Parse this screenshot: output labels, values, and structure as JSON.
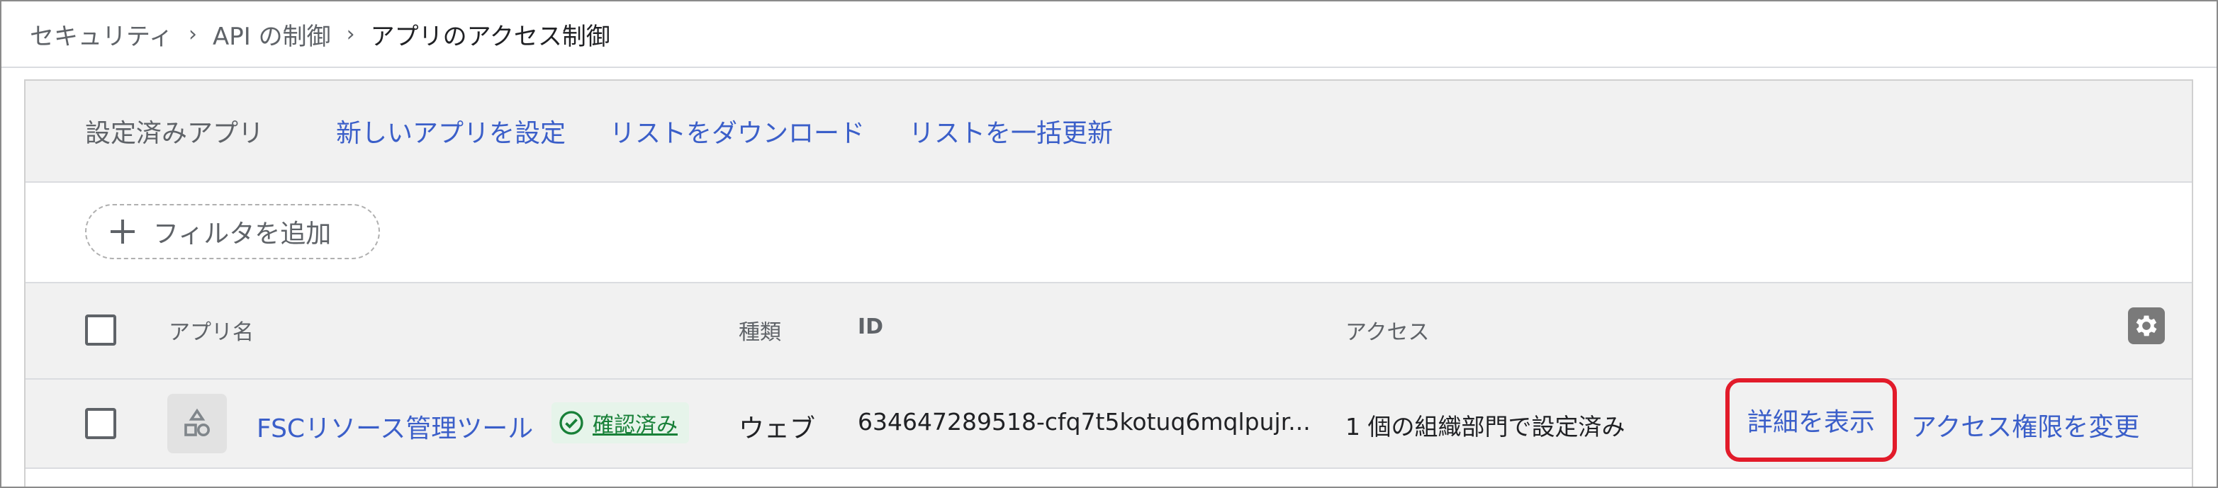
{
  "breadcrumb": {
    "items": [
      "セキュリティ",
      "API の制御",
      "アプリのアクセス制御"
    ],
    "separator": "›"
  },
  "toolbar": {
    "title": "設定済みアプリ",
    "configure_new_app": "新しいアプリを設定",
    "download_list": "リストをダウンロード",
    "bulk_update_list": "リストを一括更新"
  },
  "filter": {
    "add_filter_label": "フィルタを追加"
  },
  "table": {
    "columns": {
      "app_name": "アプリ名",
      "type": "種類",
      "id": "ID",
      "access": "アクセス"
    },
    "rows": [
      {
        "app_name": "FSCリソース管理ツール",
        "status": "確認済み",
        "type": "ウェブ",
        "id": "634647289518-cfq7t5kotuq6mqlpujr...",
        "access": "1 個の組織部門で設定済み",
        "view_details": "詳細を表示",
        "change_access": "アクセス権限を変更"
      }
    ]
  },
  "colors": {
    "link": "#3b5fc9",
    "verified_green": "#188038",
    "highlight_red": "#e21b2a"
  }
}
